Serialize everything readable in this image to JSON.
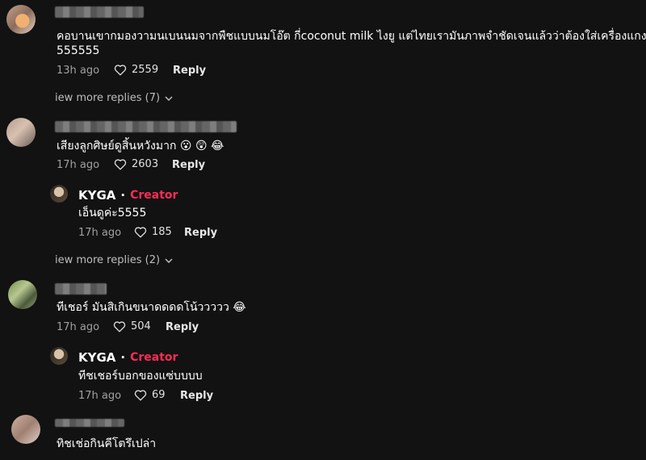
{
  "comments": [
    {
      "text": "คอบานเขากมองวามนเบนนมจากพืชแบบนมโอ๊ต กี่coconut milk ไงยู แต่ไทยเรามันภาพจำชัดเจนแล้วว่าต้องใส่เครื่องแกง",
      "text2": "555555",
      "time": "13h ago",
      "likes": "2559",
      "reply_label": "Reply",
      "view_more": "iew more replies (7)"
    },
    {
      "text": "เสียงลูกศิษย์ดูสิ้นหวังมาก",
      "emojis": "😮 😲 😂",
      "time": "17h ago",
      "likes": "2603",
      "reply_label": "Reply",
      "reply": {
        "author": "KYGA",
        "separator": "·",
        "badge": "Creator",
        "text": "เอ็นดูค่ะ5555",
        "time": "17h ago",
        "likes": "185",
        "reply_label": "Reply"
      },
      "view_more": "iew more replies (2)"
    },
    {
      "text": "ทีเชอร์ มันสิเกินขนาดดดดโน้ววววว",
      "emojis": "😂",
      "time": "17h ago",
      "likes": "504",
      "reply_label": "Reply",
      "reply": {
        "author": "KYGA",
        "separator": "·",
        "badge": "Creator",
        "text": "ทีชเชอร์บอกของแซ่บบบบ",
        "time": "17h ago",
        "likes": "69",
        "reply_label": "Reply"
      }
    },
    {
      "text": "ทิชเช่อกินคีโตรึเปล่า"
    }
  ],
  "colors": {
    "background": "#121212",
    "creator_badge": "#fe2c55",
    "meta_text": "#a0a0a0"
  }
}
